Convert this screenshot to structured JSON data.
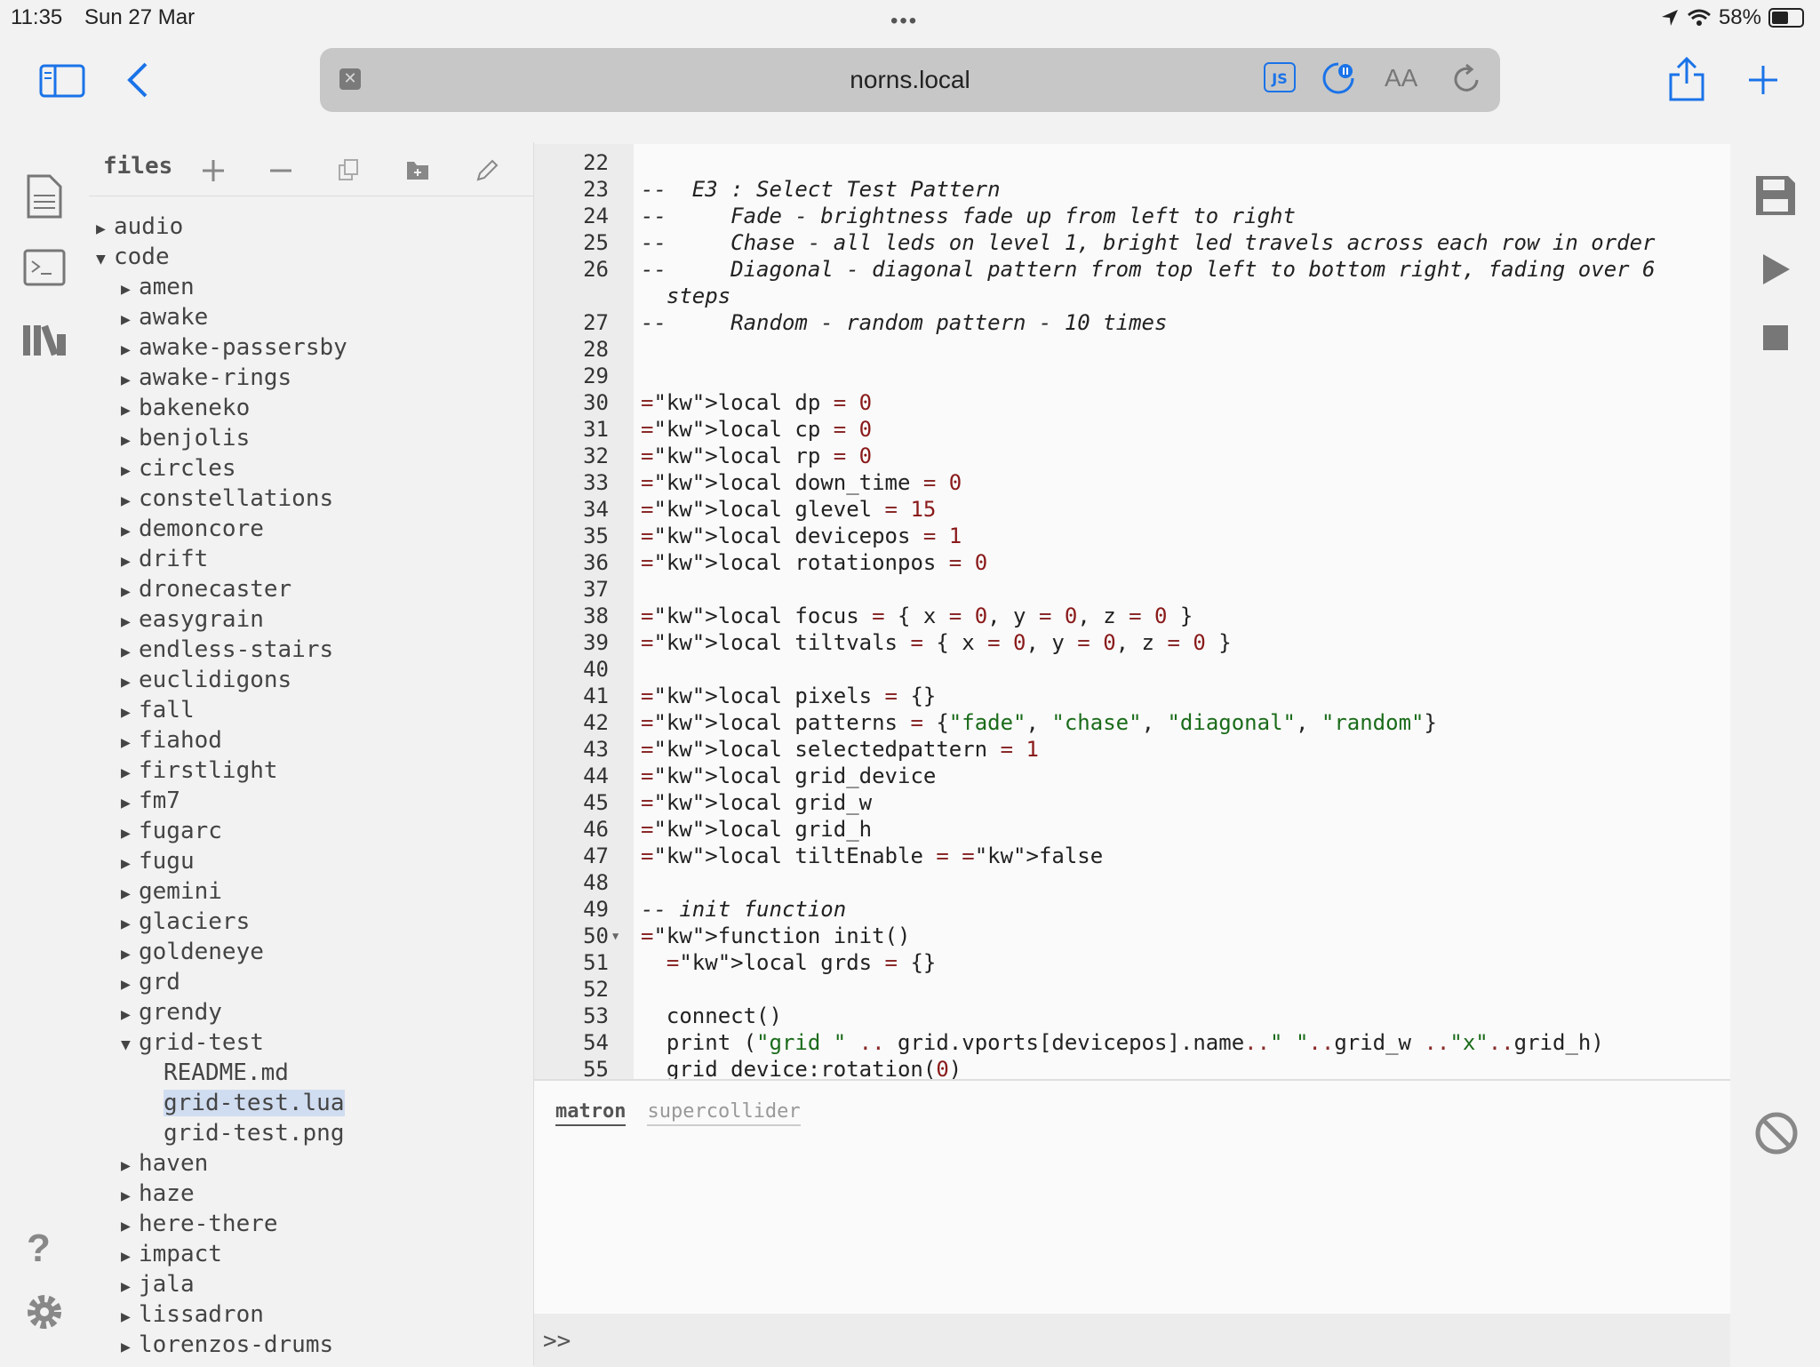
{
  "status": {
    "time": "11:35",
    "date": "Sun 27 Mar",
    "battery": "58%",
    "battery_level": 0.58
  },
  "browser": {
    "url": "norns.local",
    "js_badge": "JS",
    "text_size_label": "AA"
  },
  "files": {
    "header": "files",
    "tree": [
      {
        "label": "audio",
        "arrow": "▶",
        "indent": 0
      },
      {
        "label": "code",
        "arrow": "▼",
        "indent": 0
      },
      {
        "label": "amen",
        "arrow": "▶",
        "indent": 1
      },
      {
        "label": "awake",
        "arrow": "▶",
        "indent": 1
      },
      {
        "label": "awake-passersby",
        "arrow": "▶",
        "indent": 1
      },
      {
        "label": "awake-rings",
        "arrow": "▶",
        "indent": 1
      },
      {
        "label": "bakeneko",
        "arrow": "▶",
        "indent": 1
      },
      {
        "label": "benjolis",
        "arrow": "▶",
        "indent": 1
      },
      {
        "label": "circles",
        "arrow": "▶",
        "indent": 1
      },
      {
        "label": "constellations",
        "arrow": "▶",
        "indent": 1
      },
      {
        "label": "demoncore",
        "arrow": "▶",
        "indent": 1
      },
      {
        "label": "drift",
        "arrow": "▶",
        "indent": 1
      },
      {
        "label": "dronecaster",
        "arrow": "▶",
        "indent": 1
      },
      {
        "label": "easygrain",
        "arrow": "▶",
        "indent": 1
      },
      {
        "label": "endless-stairs",
        "arrow": "▶",
        "indent": 1
      },
      {
        "label": "euclidigons",
        "arrow": "▶",
        "indent": 1
      },
      {
        "label": "fall",
        "arrow": "▶",
        "indent": 1
      },
      {
        "label": "fiahod",
        "arrow": "▶",
        "indent": 1
      },
      {
        "label": "firstlight",
        "arrow": "▶",
        "indent": 1
      },
      {
        "label": "fm7",
        "arrow": "▶",
        "indent": 1
      },
      {
        "label": "fugarc",
        "arrow": "▶",
        "indent": 1
      },
      {
        "label": "fugu",
        "arrow": "▶",
        "indent": 1
      },
      {
        "label": "gemini",
        "arrow": "▶",
        "indent": 1
      },
      {
        "label": "glaciers",
        "arrow": "▶",
        "indent": 1
      },
      {
        "label": "goldeneye",
        "arrow": "▶",
        "indent": 1
      },
      {
        "label": "grd",
        "arrow": "▶",
        "indent": 1
      },
      {
        "label": "grendy",
        "arrow": "▶",
        "indent": 1
      },
      {
        "label": "grid-test",
        "arrow": "▼",
        "indent": 1
      },
      {
        "label": "README.md",
        "arrow": "",
        "indent": 2
      },
      {
        "label": "grid-test.lua",
        "arrow": "",
        "indent": 2,
        "selected": true
      },
      {
        "label": "grid-test.png",
        "arrow": "",
        "indent": 2
      },
      {
        "label": "haven",
        "arrow": "▶",
        "indent": 1
      },
      {
        "label": "haze",
        "arrow": "▶",
        "indent": 1
      },
      {
        "label": "here-there",
        "arrow": "▶",
        "indent": 1
      },
      {
        "label": "impact",
        "arrow": "▶",
        "indent": 1
      },
      {
        "label": "jala",
        "arrow": "▶",
        "indent": 1
      },
      {
        "label": "lissadron",
        "arrow": "▶",
        "indent": 1
      },
      {
        "label": "lorenzos-drums",
        "arrow": "▶",
        "indent": 1
      }
    ]
  },
  "editor": {
    "lines": [
      {
        "n": "22",
        "t": ""
      },
      {
        "n": "23",
        "t": "--  E3 : Select Test Pattern",
        "c": "cm"
      },
      {
        "n": "24",
        "t": "--     Fade - brightness fade up from left to right",
        "c": "cm"
      },
      {
        "n": "25",
        "t": "--     Chase - all leds on level 1, bright led travels across each row in order",
        "c": "cm"
      },
      {
        "n": "26",
        "t": "--     Diagonal - diagonal pattern from top left to bottom right, fading over 6\n  steps",
        "c": "cm",
        "wrap": true
      },
      {
        "n": "27",
        "t": "--     Random - random pattern - 10 times",
        "c": "cm"
      },
      {
        "n": "28",
        "t": ""
      },
      {
        "n": "29",
        "t": ""
      },
      {
        "n": "30",
        "t": "local dp = 0"
      },
      {
        "n": "31",
        "t": "local cp = 0"
      },
      {
        "n": "32",
        "t": "local rp = 0"
      },
      {
        "n": "33",
        "t": "local down_time = 0"
      },
      {
        "n": "34",
        "t": "local glevel = 15"
      },
      {
        "n": "35",
        "t": "local devicepos = 1"
      },
      {
        "n": "36",
        "t": "local rotationpos = 0"
      },
      {
        "n": "37",
        "t": ""
      },
      {
        "n": "38",
        "t": "local focus = { x = 0, y = 0, z = 0 }"
      },
      {
        "n": "39",
        "t": "local tiltvals = { x = 0, y = 0, z = 0 }"
      },
      {
        "n": "40",
        "t": ""
      },
      {
        "n": "41",
        "t": "local pixels = {}"
      },
      {
        "n": "42",
        "t": "local patterns = {\"fade\", \"chase\", \"diagonal\", \"random\"}"
      },
      {
        "n": "43",
        "t": "local selectedpattern = 1"
      },
      {
        "n": "44",
        "t": "local grid_device"
      },
      {
        "n": "45",
        "t": "local grid_w"
      },
      {
        "n": "46",
        "t": "local grid_h"
      },
      {
        "n": "47",
        "t": "local tiltEnable = false"
      },
      {
        "n": "48",
        "t": ""
      },
      {
        "n": "49",
        "t": "-- init function",
        "c": "cm"
      },
      {
        "n": "50",
        "t": "function init()",
        "fold": true
      },
      {
        "n": "51",
        "t": "  local grds = {}"
      },
      {
        "n": "52",
        "t": ""
      },
      {
        "n": "53",
        "t": "  connect()"
      },
      {
        "n": "54",
        "t": "  print (\"grid \" .. grid.vports[devicepos].name..\" \"..grid_w ..\"x\"..grid_h)"
      },
      {
        "n": "55",
        "t": "  grid_device:rotation(0)"
      }
    ]
  },
  "console": {
    "tabs": [
      "matron",
      "supercollider"
    ],
    "active_tab": "matron",
    "prompt": ">>"
  }
}
